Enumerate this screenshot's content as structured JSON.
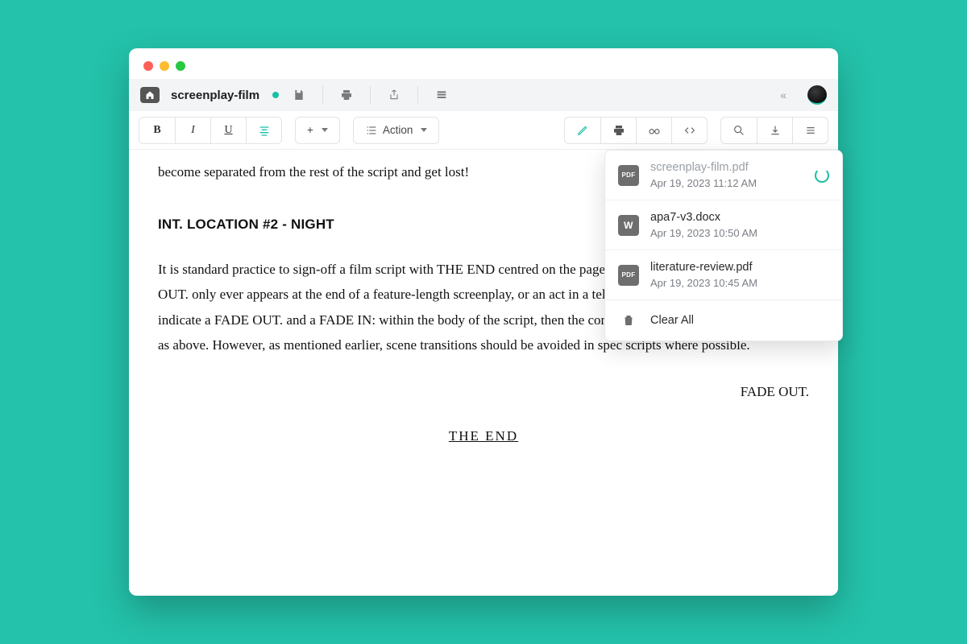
{
  "window": {
    "title": "screenplay-film"
  },
  "toolbar": {
    "bold": "B",
    "italic": "I",
    "underline": "U",
    "element_label": "Action",
    "plus": "+"
  },
  "editor": {
    "frag_top": "become separated from the rest of the script and get lost!",
    "scene": "INT. LOCATION #2 - NIGHT",
    "body": "It is standard practice to sign-off a film script with THE END centred on the page, preceded by FADE OUT. FADE OUT. only ever appears at the end of a feature-length screenplay, or an act in a television script. If you want to indicate a FADE OUT. and a FADE IN: within the body of the script, then the correct transitional term is FADE TO: as above. However, as mentioned earlier, scene transitions should be avoided in spec scripts where possible.",
    "transition": "FADE OUT.",
    "end": "THE END"
  },
  "downloads": {
    "items": [
      {
        "name": "screenplay-film.pdf",
        "meta": "Apr 19, 2023 11:12 AM",
        "kind": "pdf",
        "pending": true
      },
      {
        "name": "apa7-v3.docx",
        "meta": "Apr 19, 2023 10:50 AM",
        "kind": "w",
        "pending": false
      },
      {
        "name": "literature-review.pdf",
        "meta": "Apr 19, 2023 10:45 AM",
        "kind": "pdf",
        "pending": false
      }
    ],
    "clear": "Clear All"
  }
}
